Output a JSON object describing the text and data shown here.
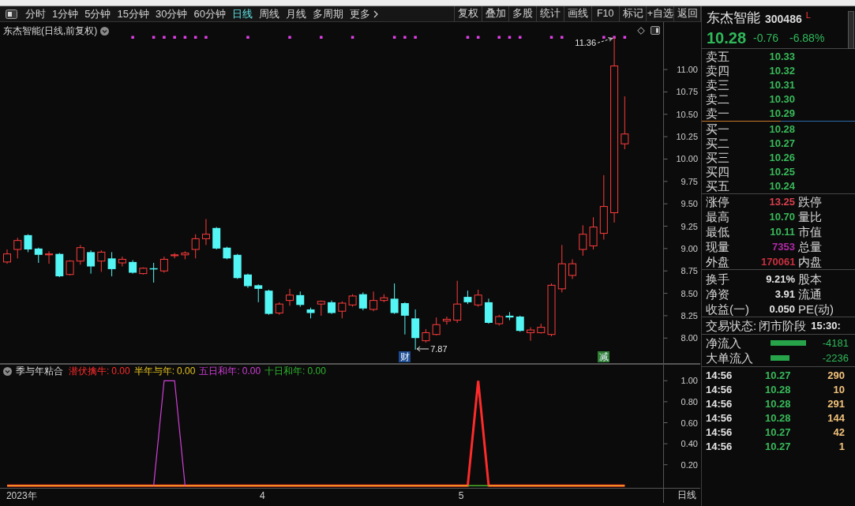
{
  "toolbar": {
    "period_tabs": [
      {
        "label": "分时",
        "selected": false
      },
      {
        "label": "1分钟",
        "selected": false
      },
      {
        "label": "5分钟",
        "selected": false
      },
      {
        "label": "15分钟",
        "selected": false
      },
      {
        "label": "30分钟",
        "selected": false
      },
      {
        "label": "60分钟",
        "selected": false
      },
      {
        "label": "日线",
        "selected": true
      },
      {
        "label": "周线",
        "selected": false
      },
      {
        "label": "月线",
        "selected": false
      },
      {
        "label": "多周期",
        "selected": false
      }
    ],
    "more_button": {
      "label": "更多"
    },
    "buttons": [
      "复权",
      "叠加",
      "多股",
      "统计",
      "画线",
      "F10",
      "标记",
      "+自选",
      "返回"
    ]
  },
  "main_chart": {
    "chart_data": [
      {
        "type": "candlestick",
        "title": "东杰智能(日线,前复权)",
        "ylim": [
          7.72,
          11.53
        ],
        "yticks": [
          {
            "value": 11,
            "label": "11.00"
          },
          {
            "value": 10.75,
            "label": "10.75"
          },
          {
            "value": 10.5,
            "label": "10.50"
          },
          {
            "value": 10.25,
            "label": "10.25"
          },
          {
            "value": 10,
            "label": "10.00"
          },
          {
            "value": 9.75,
            "label": "9.75"
          },
          {
            "value": 9.5,
            "label": "9.50"
          },
          {
            "value": 9.25,
            "label": "9.25"
          },
          {
            "value": 9,
            "label": "9.00"
          },
          {
            "value": 8.75,
            "label": "8.75"
          },
          {
            "value": 8.5,
            "label": "8.50"
          },
          {
            "value": 8.25,
            "label": "8.25"
          },
          {
            "value": 8,
            "label": "8.00"
          }
        ],
        "categories": [
          null,
          null,
          null,
          null,
          null,
          null,
          null,
          null,
          null,
          null,
          null,
          null,
          null,
          null,
          null,
          null,
          null,
          null,
          null,
          null,
          null,
          null,
          null,
          null,
          null,
          null,
          null,
          null,
          null,
          null,
          null,
          null,
          null,
          null,
          null,
          null,
          null,
          null,
          "财",
          null,
          null,
          null,
          null,
          null,
          null,
          null,
          null,
          null,
          null,
          null,
          null,
          null,
          null,
          null,
          null,
          null,
          null,
          "减",
          null,
          null
        ],
        "ohlc": [
          [
            8.85,
            8.99,
            8.83,
            8.94
          ],
          [
            8.99,
            9.12,
            8.89,
            9.09
          ],
          [
            9.15,
            9.16,
            8.96,
            8.99
          ],
          [
            9.0,
            9.01,
            8.84,
            8.93
          ],
          [
            8.93,
            8.97,
            8.83,
            8.94
          ],
          [
            8.94,
            8.95,
            8.68,
            8.69
          ],
          [
            8.71,
            8.87,
            8.7,
            8.86
          ],
          [
            8.86,
            9.04,
            8.82,
            9.01
          ],
          [
            8.96,
            8.98,
            8.72,
            8.8
          ],
          [
            8.86,
            8.98,
            8.74,
            8.96
          ],
          [
            8.89,
            8.96,
            8.69,
            8.77
          ],
          [
            8.84,
            8.91,
            8.8,
            8.88
          ],
          [
            8.85,
            8.87,
            8.72,
            8.73
          ],
          [
            8.72,
            8.79,
            8.71,
            8.78
          ],
          [
            8.78,
            8.84,
            8.62,
            8.77
          ],
          [
            8.75,
            8.91,
            8.73,
            8.88
          ],
          [
            8.92,
            8.95,
            8.89,
            8.93
          ],
          [
            8.93,
            8.97,
            8.88,
            8.95
          ],
          [
            8.99,
            9.16,
            8.89,
            9.11
          ],
          [
            9.11,
            9.33,
            9.04,
            9.16
          ],
          [
            9.23,
            9.24,
            8.99,
            9.0
          ],
          [
            9.01,
            9.02,
            8.88,
            8.89
          ],
          [
            8.93,
            8.94,
            8.66,
            8.67
          ],
          [
            8.71,
            8.72,
            8.56,
            8.58
          ],
          [
            8.59,
            8.6,
            8.4,
            8.55
          ],
          [
            8.53,
            8.54,
            8.26,
            8.27
          ],
          [
            8.28,
            8.4,
            8.26,
            8.38
          ],
          [
            8.42,
            8.55,
            8.36,
            8.48
          ],
          [
            8.48,
            8.52,
            8.35,
            8.37
          ],
          [
            8.32,
            8.34,
            8.22,
            8.28
          ],
          [
            8.38,
            8.42,
            8.25,
            8.41
          ],
          [
            8.4,
            8.42,
            8.27,
            8.28
          ],
          [
            8.3,
            8.41,
            8.22,
            8.39
          ],
          [
            8.37,
            8.49,
            8.35,
            8.47
          ],
          [
            8.49,
            8.51,
            8.31,
            8.33
          ],
          [
            8.32,
            8.52,
            8.3,
            8.42
          ],
          [
            8.42,
            8.49,
            8.4,
            8.45
          ],
          [
            8.44,
            8.61,
            8.27,
            8.28
          ],
          [
            8.39,
            8.4,
            8.04,
            8.25
          ],
          [
            8.22,
            8.32,
            7.87,
            8.0
          ],
          [
            7.97,
            8.1,
            7.95,
            8.06
          ],
          [
            8.04,
            8.23,
            8.03,
            8.15
          ],
          [
            8.19,
            8.24,
            8.15,
            8.21
          ],
          [
            8.2,
            8.64,
            8.17,
            8.38
          ],
          [
            8.46,
            8.53,
            8.38,
            8.4
          ],
          [
            8.37,
            8.54,
            8.35,
            8.48
          ],
          [
            8.4,
            8.44,
            8.16,
            8.17
          ],
          [
            8.16,
            8.26,
            8.14,
            8.24
          ],
          [
            8.25,
            8.29,
            8.2,
            8.23
          ],
          [
            8.24,
            8.25,
            8.07,
            8.08
          ],
          [
            8.06,
            8.12,
            7.97,
            8.09
          ],
          [
            8.06,
            8.16,
            8.05,
            8.12
          ],
          [
            8.04,
            8.61,
            8.02,
            8.59
          ],
          [
            8.55,
            9.04,
            8.51,
            8.83
          ],
          [
            8.7,
            8.88,
            8.66,
            8.83
          ],
          [
            8.99,
            9.26,
            8.92,
            9.16
          ],
          [
            9.03,
            9.35,
            8.99,
            9.24
          ],
          [
            9.17,
            9.82,
            9.1,
            9.47
          ],
          [
            9.4,
            11.36,
            9.29,
            11.04
          ],
          [
            10.17,
            10.7,
            10.11,
            10.28
          ]
        ],
        "series": [
          {
            "type": "scatter",
            "marker": "square",
            "color": "#e040e8",
            "values": [
              null,
              null,
              null,
              null,
              null,
              null,
              null,
              null,
              null,
              null,
              null,
              null,
              11.36,
              null,
              11.36,
              11.36,
              11.36,
              11.36,
              11.36,
              11.36,
              null,
              null,
              null,
              11.36,
              null,
              null,
              null,
              11.36,
              null,
              null,
              11.36,
              null,
              null,
              11.36,
              null,
              null,
              null,
              11.36,
              11.36,
              11.36,
              null,
              null,
              null,
              null,
              11.36,
              11.36,
              null,
              11.36,
              11.36,
              11.36,
              null,
              null,
              11.36,
              11.36,
              null,
              null,
              null,
              11.36,
              11.36,
              11.36
            ]
          }
        ],
        "annotations": [
          "11.36",
          "7.87"
        ]
      }
    ],
    "badges": [
      {
        "color": "#1d4b8f"
      },
      {
        "color": "#2e7d32"
      }
    ]
  },
  "indicator_pane": {
    "chart_data": [
      {
        "type": "line",
        "title": "季与年粘合",
        "ylim": [
          -0.02,
          1.16
        ],
        "yticks": [
          {
            "value": 1,
            "label": "1.00"
          },
          {
            "value": 0.8,
            "label": "0.80"
          },
          {
            "value": 0.6,
            "label": "0.60"
          },
          {
            "value": 0.4,
            "label": "0.40"
          },
          {
            "value": 0.2,
            "label": "0.20"
          }
        ],
        "categories": [
          null,
          "2023年",
          null,
          null,
          null,
          null,
          null,
          null,
          null,
          null,
          null,
          null,
          null,
          null,
          null,
          null,
          null,
          null,
          null,
          null,
          null,
          null,
          null,
          null,
          "4",
          null,
          null,
          null,
          null,
          null,
          null,
          null,
          null,
          null,
          null,
          null,
          null,
          null,
          null,
          null,
          null,
          null,
          null,
          "5",
          null,
          null,
          null,
          null,
          null,
          null,
          null,
          null,
          null,
          null,
          null,
          null,
          null,
          null,
          null,
          null
        ],
        "series": [
          {
            "name": "潜伏擒牛:",
            "color": "#ff2b2b",
            "values": [
              0,
              0,
              0,
              0,
              0,
              0,
              0,
              0,
              0,
              0,
              0,
              0,
              0,
              0,
              0,
              0,
              0,
              0,
              0,
              0,
              0,
              0,
              0,
              0,
              0,
              0,
              0,
              0,
              0,
              0,
              0,
              0,
              0,
              0,
              0,
              0,
              0,
              0,
              0,
              0,
              0,
              0,
              0,
              0,
              0,
              1,
              0,
              0,
              0,
              0,
              0,
              0,
              0,
              0,
              0,
              0,
              0,
              0,
              0,
              0
            ]
          },
          {
            "name": "半年与年:",
            "color": "#e6c21e",
            "values": [
              0,
              0,
              0,
              0,
              0,
              0,
              0,
              0,
              0,
              0,
              0,
              0,
              0,
              0,
              0,
              0,
              0,
              0,
              0,
              0,
              0,
              0,
              0,
              0,
              0,
              0,
              0,
              0,
              0,
              0,
              0,
              0,
              0,
              0,
              0,
              0,
              0,
              0,
              0,
              0,
              0,
              0,
              0,
              0,
              0,
              0,
              0,
              0,
              0,
              0,
              0,
              0,
              0,
              0,
              0,
              0,
              0,
              0,
              0,
              0
            ]
          },
          {
            "name": "五日和年:",
            "color": "#d23fd8",
            "values": [
              null,
              null,
              null,
              null,
              null,
              null,
              null,
              null,
              null,
              null,
              null,
              null,
              null,
              null,
              0,
              1,
              1,
              0,
              null,
              null,
              null,
              null,
              null,
              null,
              null,
              null,
              null,
              null,
              null,
              null,
              null,
              null,
              null,
              null,
              null,
              null,
              null,
              null,
              null,
              null,
              null,
              null,
              null,
              null,
              null,
              null,
              null,
              null,
              null,
              null,
              null,
              null,
              null,
              null,
              null,
              null,
              null,
              null,
              null,
              null
            ]
          },
          {
            "name": "十日和年:",
            "color": "#2fb52f",
            "values": [
              null,
              null,
              null,
              null,
              null,
              null,
              null,
              null,
              null,
              null,
              null,
              null,
              null,
              null,
              null,
              null,
              null,
              null,
              null,
              null,
              null,
              null,
              null,
              null,
              null,
              null,
              null,
              null,
              null,
              null,
              null,
              null,
              null,
              null,
              null,
              null,
              null,
              null,
              null,
              null,
              null,
              null,
              null,
              null,
              0,
              0,
              0,
              null,
              null,
              null,
              null,
              null,
              null,
              null,
              null,
              null,
              null,
              null,
              null,
              null
            ]
          }
        ]
      }
    ],
    "legend_readings": [
      "0.00",
      "0.00",
      "0.00",
      "0.00"
    ],
    "period_label": "日线"
  },
  "quote": {
    "name": "东杰智能",
    "code": "300486",
    "flag": "L",
    "price": "10.28",
    "change": "-0.76",
    "change_percent": "-6.88%"
  },
  "order_book": {
    "asks": [
      {
        "label": "卖五",
        "price": "10.33"
      },
      {
        "label": "卖四",
        "price": "10.32"
      },
      {
        "label": "卖三",
        "price": "10.31"
      },
      {
        "label": "卖二",
        "price": "10.30"
      },
      {
        "label": "卖一",
        "price": "10.29"
      }
    ],
    "bids": [
      {
        "label": "买一",
        "price": "10.28"
      },
      {
        "label": "买二",
        "price": "10.27"
      },
      {
        "label": "买三",
        "price": "10.26"
      },
      {
        "label": "买四",
        "price": "10.25"
      },
      {
        "label": "买五",
        "price": "10.24"
      }
    ]
  },
  "price_stats": [
    {
      "label": "涨停",
      "value": "13.25",
      "color": "#d9404e",
      "label_2": "跌停"
    },
    {
      "label": "最高",
      "value": "10.70",
      "color": "#38b95a",
      "label_2": "量比"
    },
    {
      "label": "最低",
      "value": "10.11",
      "color": "#38b95a",
      "label_2": "市值"
    },
    {
      "label": "现量",
      "value": "7353",
      "color": "#b02aa5",
      "label_2": "总量"
    },
    {
      "label": "外盘",
      "value": "170061",
      "color": "#c8303f",
      "label_2": "内盘"
    }
  ],
  "share_stats": [
    {
      "label": "换手",
      "value": "9.21%",
      "label_2": "股本"
    },
    {
      "label": "净资",
      "value": "3.91",
      "label_2": "流通"
    },
    {
      "label": "收益(一)",
      "value": "0.050",
      "label_2": "PE(动)"
    }
  ],
  "trade_status": {
    "label": "交易状态:",
    "value": "闭市阶段",
    "time": "15:30:"
  },
  "fund_flow": [
    {
      "label": "净流入",
      "value": "-4181"
    },
    {
      "label": "大单流入",
      "value": "-2236"
    }
  ],
  "trades": [
    {
      "time": "14:56",
      "price": "10.27",
      "volume": "290"
    },
    {
      "time": "14:56",
      "price": "10.28",
      "volume": "10"
    },
    {
      "time": "14:56",
      "price": "10.28",
      "volume": "291"
    },
    {
      "time": "14:56",
      "price": "10.28",
      "volume": "144"
    },
    {
      "time": "14:56",
      "price": "10.27",
      "volume": "42"
    },
    {
      "time": "14:56",
      "price": "10.27",
      "volume": "1"
    }
  ]
}
